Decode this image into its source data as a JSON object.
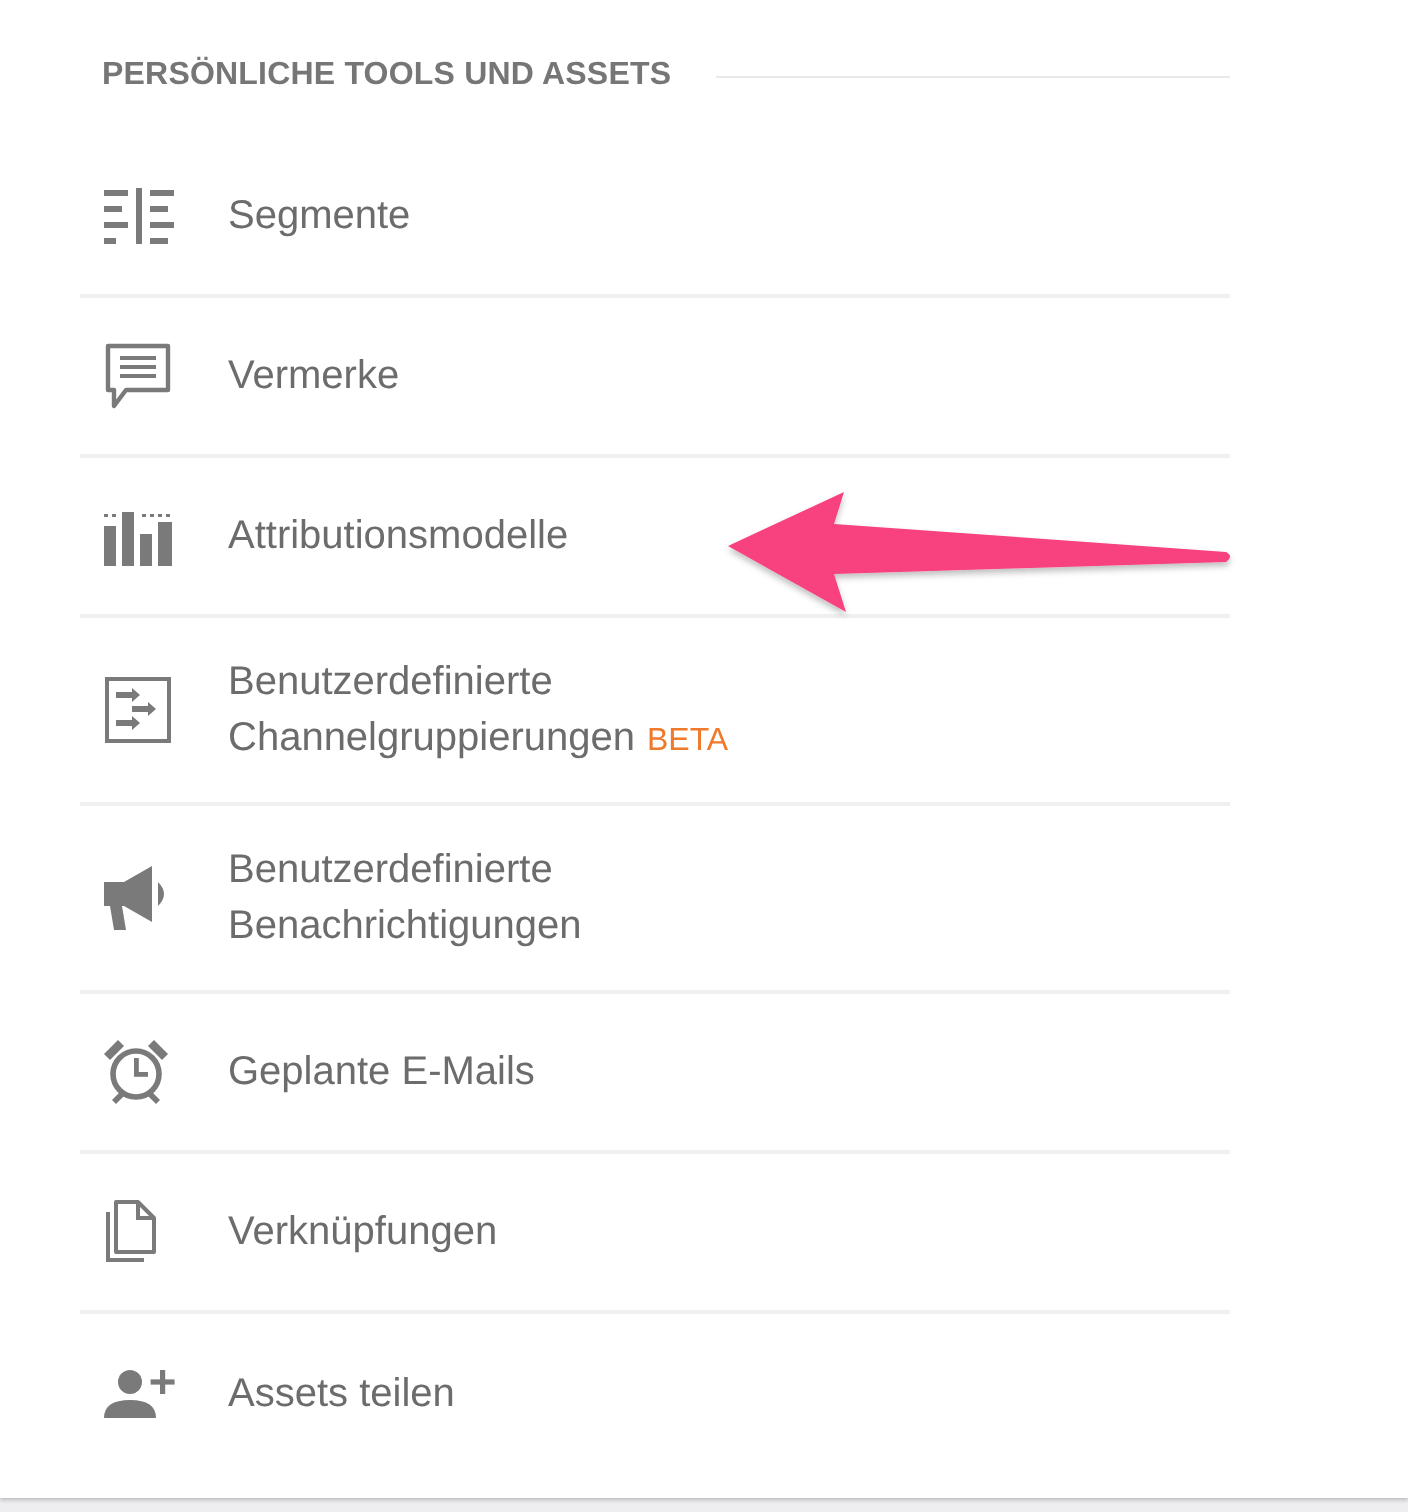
{
  "section": {
    "heading": "PERSÖNLICHE TOOLS UND ASSETS"
  },
  "items": [
    {
      "kind": "segments",
      "lines": [
        "Segmente"
      ],
      "arrow_pointer": false
    },
    {
      "kind": "notes",
      "lines": [
        "Vermerke"
      ],
      "arrow_pointer": false
    },
    {
      "kind": "bar-chart",
      "lines": [
        "Attributionsmodelle"
      ],
      "arrow_pointer": true
    },
    {
      "kind": "channels",
      "lines": [
        "Benutzerdefinierte",
        "Channelgruppierungen"
      ],
      "badge": "BETA",
      "arrow_pointer": false
    },
    {
      "kind": "megaphone",
      "lines": [
        "Benutzerdefinierte",
        "Benachrichtigungen"
      ],
      "arrow_pointer": false
    },
    {
      "kind": "alarm",
      "lines": [
        "Geplante E-Mails"
      ],
      "arrow_pointer": false
    },
    {
      "kind": "documents",
      "lines": [
        "Verknüpfungen"
      ],
      "arrow_pointer": false
    },
    {
      "kind": "add-person",
      "lines": [
        "Assets teilen"
      ],
      "arrow_pointer": false
    }
  ]
}
